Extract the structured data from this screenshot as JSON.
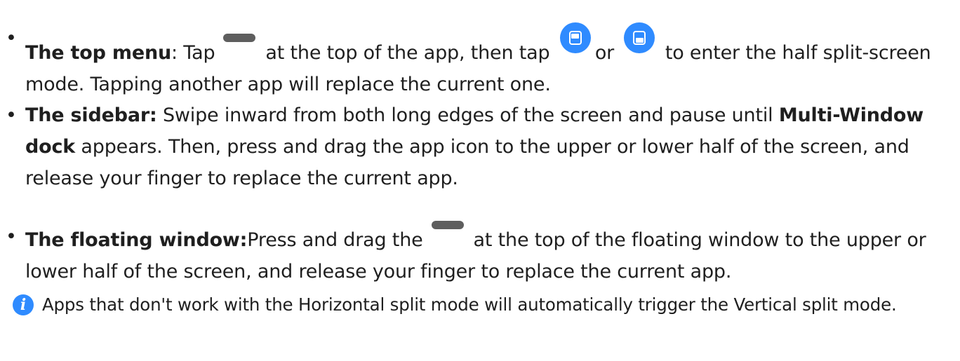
{
  "bullets": [
    {
      "marker": "•",
      "bold": "The top menu",
      "text_1": ": Tap",
      "text_2": "at the top of the app, then tap",
      "text_3": "or",
      "text_4": "to enter the half split-screen mode. Tapping another app will replace the current one."
    },
    {
      "marker": "•",
      "bold": "The sidebar:",
      "text_1": " Swipe inward from both long edges of the screen and pause until",
      "bold_2": "Multi-Window dock",
      "text_2": " appears. Then, press and drag the app icon to the upper or lower half of the screen, and release your finger to replace the current app."
    },
    {
      "marker": "•",
      "bold": "The floating window:",
      "text_1": "Press and drag the",
      "text_2": "at the top of the floating window to the upper or lower half of the screen, and release your finger to replace the current app."
    }
  ],
  "note": {
    "icon": "i",
    "text": "Apps that don't work with the Horizontal split mode will automatically trigger the Vertical split mode."
  },
  "colors": {
    "accent": "#2f8bff",
    "handle": "#5e5e5e",
    "text": "#1f1f1f"
  },
  "icons": [
    "handle-bar-icon",
    "split-top-icon",
    "split-bottom-icon",
    "info-icon"
  ]
}
